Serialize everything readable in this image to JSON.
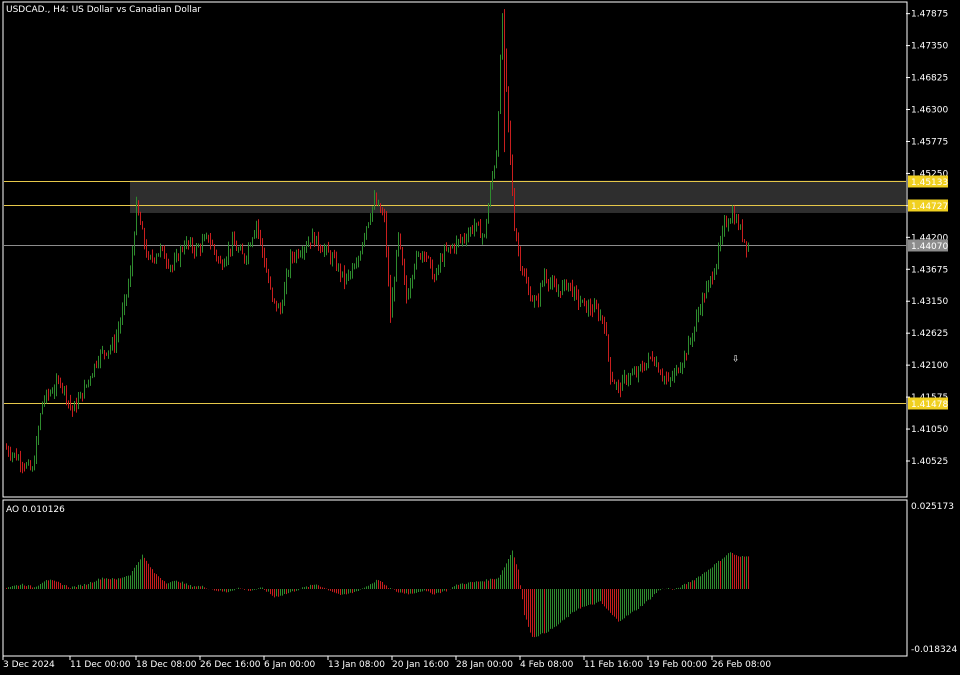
{
  "header": {
    "symbol": "USDCAD.",
    "timeframe": "H4",
    "description": "US Dollar vs Canadian Dollar"
  },
  "colors": {
    "background": "#000000",
    "frame": "#ffffff",
    "bull": "#2e8b2e",
    "bear": "#c81e1e",
    "level_line": "#e6c84a",
    "level_tag": "#f0d020",
    "level_tag_text": "#000000",
    "current_line": "#8c8c8c",
    "current_tag": "#8c8c8c",
    "zone_fill": "#2e2e2e",
    "ao_up": "#2e8b2e",
    "ao_down": "#c81e1e"
  },
  "chart_data": [
    {
      "type": "candlestick",
      "title": "USDCAD., H4:  US Dollar vs Canadian Dollar",
      "ylim": [
        1.3995,
        1.4805
      ],
      "price_ticks": [
        "1.47875",
        "1.47350",
        "1.46825",
        "1.46300",
        "1.45775",
        "1.45250",
        "1.44720",
        "1.44200",
        "1.43675",
        "1.43150",
        "1.42625",
        "1.42100",
        "1.41575",
        "1.41050",
        "1.40525"
      ],
      "x_labels": [
        "3 Dec 2024",
        "11 Dec 00:00",
        "18 Dec 08:00",
        "26 Dec 16:00",
        "6 Jan 00:00",
        "13 Jan 08:00",
        "20 Jan 16:00",
        "28 Jan 00:00",
        "4 Feb 08:00",
        "11 Feb 16:00",
        "19 Feb 00:00",
        "26 Feb 08:00"
      ],
      "x_label_positions": [
        0,
        32,
        65,
        97,
        129,
        161,
        193,
        225,
        257,
        289,
        321,
        353
      ],
      "bar_count": 372,
      "current_price": "1.44070",
      "levels": [
        {
          "label": "1.45133",
          "value": 1.45133
        },
        {
          "label": "1.44727",
          "value": 1.44727
        },
        {
          "label": "1.41478",
          "value": 1.41478
        }
      ],
      "zone": {
        "from_bar": 62,
        "top": 1.45133,
        "bottom": 1.446
      },
      "arrow": {
        "bar": 366,
        "price": 1.4216,
        "direction": "down"
      },
      "path_points": [
        [
          0,
          1.4075
        ],
        [
          6,
          1.406
        ],
        [
          14,
          1.4035
        ],
        [
          19,
          1.415
        ],
        [
          28,
          1.4185
        ],
        [
          34,
          1.4135
        ],
        [
          40,
          1.417
        ],
        [
          47,
          1.4225
        ],
        [
          55,
          1.4245
        ],
        [
          60,
          1.431
        ],
        [
          63,
          1.436
        ],
        [
          66,
          1.447
        ],
        [
          72,
          1.438
        ],
        [
          78,
          1.44
        ],
        [
          84,
          1.437
        ],
        [
          90,
          1.441
        ],
        [
          96,
          1.44
        ],
        [
          102,
          1.442
        ],
        [
          108,
          1.4375
        ],
        [
          114,
          1.441
        ],
        [
          120,
          1.4385
        ],
        [
          126,
          1.4445
        ],
        [
          130,
          1.438
        ],
        [
          134,
          1.4315
        ],
        [
          138,
          1.43
        ],
        [
          143,
          1.4385
        ],
        [
          148,
          1.44
        ],
        [
          154,
          1.442
        ],
        [
          160,
          1.44
        ],
        [
          165,
          1.438
        ],
        [
          170,
          1.435
        ],
        [
          176,
          1.437
        ],
        [
          180,
          1.443
        ],
        [
          185,
          1.448
        ],
        [
          190,
          1.445
        ],
        [
          193,
          1.429
        ],
        [
          197,
          1.442
        ],
        [
          201,
          1.432
        ],
        [
          205,
          1.438
        ],
        [
          210,
          1.44
        ],
        [
          215,
          1.435
        ],
        [
          219,
          1.439
        ],
        [
          224,
          1.4405
        ],
        [
          230,
          1.442
        ],
        [
          235,
          1.444
        ],
        [
          240,
          1.442
        ],
        [
          243,
          1.45
        ],
        [
          246,
          1.456
        ],
        [
          249,
          1.478
        ],
        [
          252,
          1.46
        ],
        [
          255,
          1.444
        ],
        [
          258,
          1.438
        ],
        [
          262,
          1.433
        ],
        [
          266,
          1.431
        ],
        [
          270,
          1.436
        ],
        [
          276,
          1.433
        ],
        [
          282,
          1.4345
        ],
        [
          286,
          1.432
        ],
        [
          291,
          1.4305
        ],
        [
          296,
          1.43
        ],
        [
          300,
          1.428
        ],
        [
          303,
          1.4195
        ],
        [
          307,
          1.417
        ],
        [
          311,
          1.419
        ],
        [
          316,
          1.4195
        ],
        [
          320,
          1.421
        ],
        [
          324,
          1.4225
        ],
        [
          328,
          1.42
        ],
        [
          332,
          1.418
        ],
        [
          336,
          1.42
        ],
        [
          340,
          1.4225
        ],
        [
          344,
          1.426
        ],
        [
          348,
          1.431
        ],
        [
          352,
          1.434
        ],
        [
          356,
          1.438
        ],
        [
          360,
          1.444
        ],
        [
          364,
          1.446
        ],
        [
          367,
          1.444
        ],
        [
          371,
          1.4407
        ]
      ]
    },
    {
      "type": "bar",
      "name": "AO",
      "title": "AO 0.010126",
      "ylim": [
        -0.018324,
        0.025173
      ],
      "tick_labels": [
        "0.025173",
        "-0.018324"
      ],
      "current_value": "0.010126",
      "path_points": [
        [
          0,
          0.0005
        ],
        [
          8,
          0.0015
        ],
        [
          14,
          0.0005
        ],
        [
          20,
          0.003
        ],
        [
          26,
          0.002
        ],
        [
          32,
          0.0005
        ],
        [
          40,
          0.0015
        ],
        [
          48,
          0.0035
        ],
        [
          55,
          0.003
        ],
        [
          62,
          0.0045
        ],
        [
          68,
          0.0105
        ],
        [
          74,
          0.005
        ],
        [
          80,
          0.002
        ],
        [
          86,
          0.0025
        ],
        [
          92,
          0.001
        ],
        [
          98,
          0.0008
        ],
        [
          104,
          -0.0003
        ],
        [
          110,
          -0.001
        ],
        [
          116,
          0.0003
        ],
        [
          122,
          -0.0005
        ],
        [
          128,
          0.0003
        ],
        [
          134,
          -0.0025
        ],
        [
          140,
          -0.0015
        ],
        [
          148,
          0.0003
        ],
        [
          155,
          0.0015
        ],
        [
          162,
          -0.0005
        ],
        [
          168,
          -0.002
        ],
        [
          174,
          -0.001
        ],
        [
          180,
          0.0008
        ],
        [
          186,
          0.003
        ],
        [
          190,
          0.0008
        ],
        [
          196,
          -0.001
        ],
        [
          202,
          -0.0015
        ],
        [
          208,
          -0.0005
        ],
        [
          214,
          -0.0015
        ],
        [
          220,
          -0.0005
        ],
        [
          226,
          0.0015
        ],
        [
          232,
          0.002
        ],
        [
          238,
          0.0025
        ],
        [
          242,
          0.003
        ],
        [
          246,
          0.0035
        ],
        [
          250,
          0.008
        ],
        [
          253,
          0.012
        ],
        [
          256,
          0.006
        ],
        [
          259,
          -0.008
        ],
        [
          263,
          -0.015
        ],
        [
          268,
          -0.014
        ],
        [
          274,
          -0.012
        ],
        [
          280,
          -0.009
        ],
        [
          286,
          -0.006
        ],
        [
          292,
          -0.005
        ],
        [
          297,
          -0.004
        ],
        [
          302,
          -0.0075
        ],
        [
          306,
          -0.01
        ],
        [
          310,
          -0.0085
        ],
        [
          316,
          -0.006
        ],
        [
          322,
          -0.003
        ],
        [
          326,
          -0.0005
        ],
        [
          330,
          0.0003
        ],
        [
          334,
          -0.0003
        ],
        [
          338,
          0.001
        ],
        [
          344,
          0.003
        ],
        [
          350,
          0.0055
        ],
        [
          356,
          0.0085
        ],
        [
          362,
          0.0115
        ],
        [
          366,
          0.01
        ],
        [
          371,
          0.0101
        ]
      ]
    }
  ]
}
